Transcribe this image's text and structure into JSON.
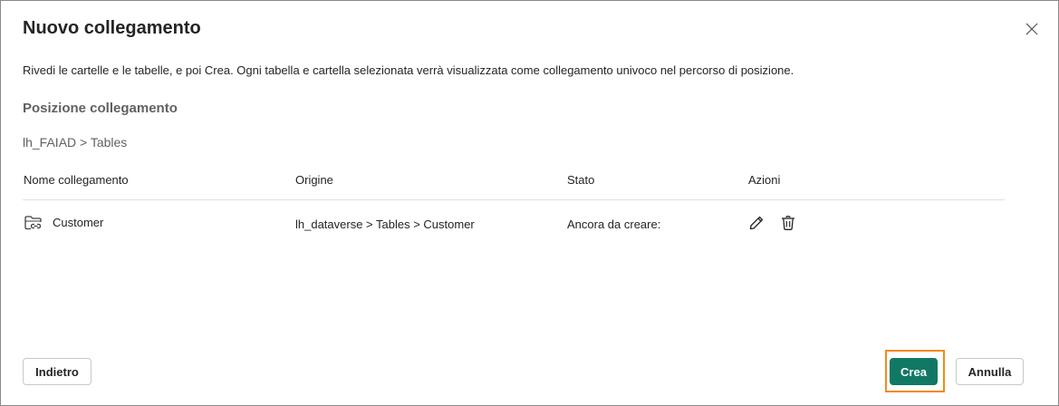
{
  "dialog": {
    "title": "Nuovo collegamento",
    "description": "Rivedi le cartelle e le tabelle, e poi Crea. Ogni tabella e cartella selezionata verrà visualizzata come collegamento univoco nel percorso di posizione.",
    "location_label": "Posizione collegamento",
    "location_path": "lh_FAIAD > Tables"
  },
  "table": {
    "headers": {
      "name": "Nome collegamento",
      "origin": "Origine",
      "state": "Stato",
      "actions": "Azioni"
    },
    "rows": [
      {
        "name": "Customer",
        "origin": "lh_dataverse > Tables > Customer",
        "state": "Ancora da creare:",
        "icon": "folder-link-icon"
      }
    ]
  },
  "footer": {
    "back_label": "Indietro",
    "create_label": "Crea",
    "cancel_label": "Annulla"
  },
  "colors": {
    "primary": "#117865",
    "highlight": "#f28a1c",
    "border": "#8a8a8a"
  }
}
